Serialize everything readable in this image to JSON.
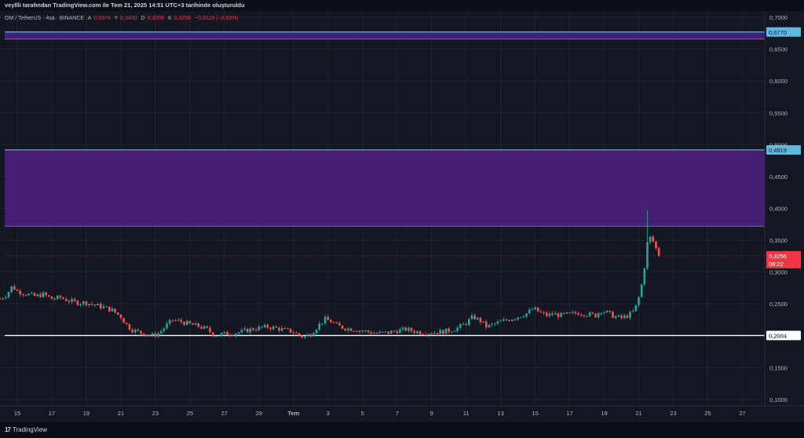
{
  "attribution": "veyllli tarafından TradingView.com ile Tem 21, 2025 14:51 UTC+3 tarihinde oluşturuldu",
  "legend": {
    "symbol": "OM / TetherUS · 4sa · BINANCE",
    "open_label": "A",
    "open": "0,3374",
    "high_label": "Y",
    "high": "0,3430",
    "low_label": "D",
    "low": "0,3209",
    "close_label": "K",
    "close": "0,3256",
    "change": "−0,0119 (−3,53%)"
  },
  "footer": {
    "brand": "TradingView",
    "logo_glyph": "17"
  },
  "colors": {
    "background": "#131722",
    "grid": "#1f2433",
    "up": "#26a69a",
    "down": "#ef5350",
    "zone_fill": "#4a1f7a",
    "zone_line": "#5fb8e0",
    "support_line": "#ffffff",
    "price_badge": "#f23645"
  },
  "chart_data": {
    "type": "candlestick",
    "title": "",
    "xlabel": "",
    "ylabel": "",
    "ylim": [
      0.09,
      0.71
    ],
    "y_ticks": [
      {
        "value": 0.7,
        "label": "0,7000"
      },
      {
        "value": 0.65,
        "label": "0,6500"
      },
      {
        "value": 0.6,
        "label": "0,6000"
      },
      {
        "value": 0.55,
        "label": "0,5500"
      },
      {
        "value": 0.5,
        "label": "0,5000"
      },
      {
        "value": 0.45,
        "label": "0,4500"
      },
      {
        "value": 0.4,
        "label": "0,4000"
      },
      {
        "value": 0.35,
        "label": "0,3500"
      },
      {
        "value": 0.3,
        "label": "0,3000"
      },
      {
        "value": 0.25,
        "label": "0,2500"
      },
      {
        "value": 0.2,
        "label": "0,2000"
      },
      {
        "value": 0.15,
        "label": "0,1500"
      },
      {
        "value": 0.1,
        "label": "0,1000"
      }
    ],
    "x_ticks": [
      {
        "day": 0,
        "label": "15"
      },
      {
        "day": 2,
        "label": "17"
      },
      {
        "day": 4,
        "label": "19"
      },
      {
        "day": 6,
        "label": "21"
      },
      {
        "day": 8,
        "label": "23"
      },
      {
        "day": 10,
        "label": "25"
      },
      {
        "day": 12,
        "label": "27"
      },
      {
        "day": 14,
        "label": "29"
      },
      {
        "day": 16,
        "label": "Tem"
      },
      {
        "day": 18,
        "label": "3"
      },
      {
        "day": 20,
        "label": "5"
      },
      {
        "day": 22,
        "label": "7"
      },
      {
        "day": 24,
        "label": "9"
      },
      {
        "day": 26,
        "label": "11"
      },
      {
        "day": 28,
        "label": "13"
      },
      {
        "day": 30,
        "label": "15"
      },
      {
        "day": 32,
        "label": "17"
      },
      {
        "day": 34,
        "label": "19"
      },
      {
        "day": 36,
        "label": "21"
      },
      {
        "day": 38,
        "label": "23"
      },
      {
        "day": 40,
        "label": "25"
      },
      {
        "day": 42,
        "label": "27"
      }
    ],
    "x_range_days": [
      -1.0,
      43.3
    ],
    "zones": [
      {
        "from": 0.666,
        "to": 0.677,
        "label": "0,6770"
      },
      {
        "from": 0.372,
        "to": 0.4919,
        "label": "0,4919"
      }
    ],
    "support": {
      "value": 0.2004,
      "label": "0,2004"
    },
    "current": {
      "value": 0.3256,
      "label": "0,3256",
      "countdown": "08:22"
    },
    "price_path": [
      [
        -1.0,
        0.258
      ],
      [
        -0.6,
        0.265
      ],
      [
        -0.3,
        0.278
      ],
      [
        0.0,
        0.27
      ],
      [
        0.5,
        0.266
      ],
      [
        1.0,
        0.262
      ],
      [
        1.5,
        0.265
      ],
      [
        2.0,
        0.258
      ],
      [
        2.5,
        0.26
      ],
      [
        3.0,
        0.255
      ],
      [
        3.5,
        0.252
      ],
      [
        4.0,
        0.252
      ],
      [
        4.5,
        0.248
      ],
      [
        5.0,
        0.245
      ],
      [
        5.5,
        0.24
      ],
      [
        6.0,
        0.23
      ],
      [
        6.3,
        0.218
      ],
      [
        6.6,
        0.21
      ],
      [
        7.0,
        0.206
      ],
      [
        7.4,
        0.203
      ],
      [
        7.8,
        0.2
      ],
      [
        8.2,
        0.204
      ],
      [
        8.6,
        0.215
      ],
      [
        9.0,
        0.225
      ],
      [
        9.5,
        0.222
      ],
      [
        10.0,
        0.218
      ],
      [
        10.5,
        0.215
      ],
      [
        11.0,
        0.21
      ],
      [
        11.3,
        0.203
      ],
      [
        11.6,
        0.201
      ],
      [
        12.0,
        0.203
      ],
      [
        12.5,
        0.204
      ],
      [
        13.0,
        0.206
      ],
      [
        13.5,
        0.21
      ],
      [
        14.0,
        0.212
      ],
      [
        14.5,
        0.214
      ],
      [
        15.0,
        0.212
      ],
      [
        15.5,
        0.209
      ],
      [
        16.0,
        0.206
      ],
      [
        16.3,
        0.201
      ],
      [
        16.6,
        0.198
      ],
      [
        17.0,
        0.203
      ],
      [
        17.4,
        0.215
      ],
      [
        17.8,
        0.226
      ],
      [
        18.2,
        0.222
      ],
      [
        18.6,
        0.215
      ],
      [
        19.0,
        0.212
      ],
      [
        19.5,
        0.21
      ],
      [
        20.0,
        0.208
      ],
      [
        20.5,
        0.205
      ],
      [
        21.0,
        0.204
      ],
      [
        21.5,
        0.205
      ],
      [
        22.0,
        0.208
      ],
      [
        22.5,
        0.21
      ],
      [
        23.0,
        0.207
      ],
      [
        23.5,
        0.205
      ],
      [
        24.0,
        0.205
      ],
      [
        24.5,
        0.206
      ],
      [
        25.0,
        0.208
      ],
      [
        25.5,
        0.212
      ],
      [
        26.0,
        0.22
      ],
      [
        26.4,
        0.23
      ],
      [
        26.8,
        0.224
      ],
      [
        27.2,
        0.214
      ],
      [
        27.6,
        0.218
      ],
      [
        28.0,
        0.222
      ],
      [
        28.5,
        0.226
      ],
      [
        29.0,
        0.23
      ],
      [
        29.5,
        0.235
      ],
      [
        29.9,
        0.243
      ],
      [
        30.3,
        0.236
      ],
      [
        30.7,
        0.232
      ],
      [
        31.0,
        0.234
      ],
      [
        31.5,
        0.232
      ],
      [
        32.0,
        0.234
      ],
      [
        32.5,
        0.236
      ],
      [
        33.0,
        0.234
      ],
      [
        33.5,
        0.232
      ],
      [
        33.8,
        0.24
      ],
      [
        34.2,
        0.236
      ],
      [
        34.6,
        0.23
      ],
      [
        35.0,
        0.228
      ],
      [
        35.4,
        0.232
      ],
      [
        35.7,
        0.238
      ],
      [
        35.9,
        0.25
      ],
      [
        36.1,
        0.27
      ],
      [
        36.3,
        0.3
      ],
      [
        36.45,
        0.34
      ],
      [
        36.6,
        0.356
      ],
      [
        36.75,
        0.352
      ],
      [
        36.9,
        0.345
      ],
      [
        37.05,
        0.333
      ],
      [
        37.2,
        0.3256
      ]
    ],
    "spike_high": {
      "day": 36.55,
      "value": 0.397
    }
  }
}
